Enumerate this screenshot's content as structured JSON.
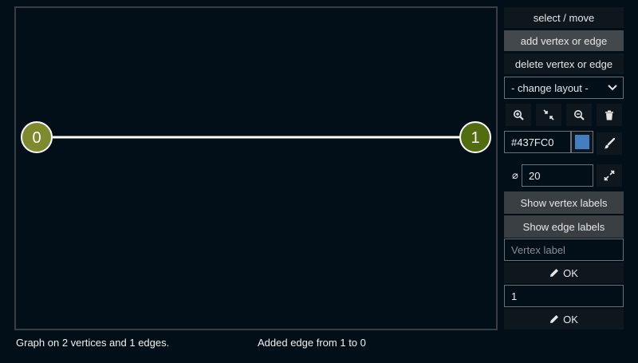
{
  "canvas": {
    "vertices": [
      {
        "label": "0",
        "color": "#7f8a2e"
      },
      {
        "label": "1",
        "color": "#516d10"
      }
    ],
    "edge_color": "#ffffff",
    "vertex_stroke": "#ffffff"
  },
  "status": {
    "graph_info": "Graph on 2 vertices and 1 edges.",
    "last_action": "Added edge from 1 to 0"
  },
  "toolbar": {
    "select_move": "select / move",
    "add_vertex_edge": "add vertex or edge",
    "delete_vertex_edge": "delete vertex or edge",
    "layout_select": "- change layout -",
    "color_value": "#437FC0",
    "swatch_color": "#437fc0",
    "diameter_symbol": "⌀",
    "diameter_value": "20",
    "show_vertex_labels": "Show vertex labels",
    "show_edge_labels": "Show edge labels",
    "vertex_label_placeholder": "Vertex label",
    "ok_label": "OK",
    "edge_label_value": "1",
    "ok_label_2": "OK"
  }
}
